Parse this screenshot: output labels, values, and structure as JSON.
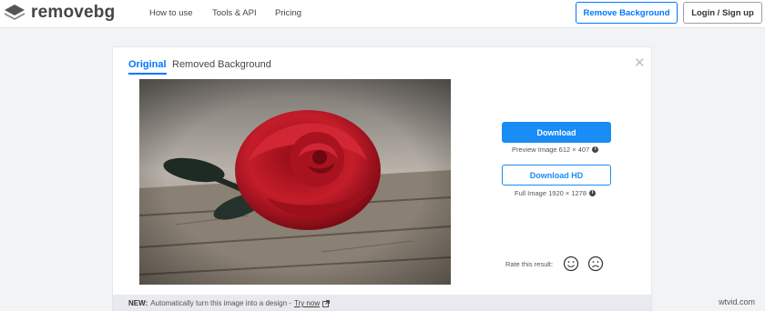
{
  "header": {
    "logo_text_a": "remove",
    "logo_text_b": "bg",
    "nav": [
      "How to use",
      "Tools & API",
      "Pricing"
    ],
    "remove_bg_button": "Remove Background",
    "login_button": "Login / Sign up"
  },
  "card": {
    "tabs": [
      "Original",
      "Removed Background"
    ],
    "active_tab": "Original",
    "download_button": "Download",
    "preview_caption": "Preview Image 612 × 407",
    "download_hd_button": "Download HD",
    "full_caption": "Full Image 1920 × 1278",
    "rate_label": "Rate this result:",
    "footer_new": "NEW:",
    "footer_text": "Automatically turn this image into a design -",
    "footer_link": "Try now"
  },
  "watermark": "wtvid.com",
  "colors": {
    "accent": "#0077ff",
    "download_fill": "#1a8cf5",
    "page_bg": "#f2f3f5"
  },
  "icons": {
    "logo": "layers-logo-icon",
    "close": "close-icon",
    "info": "info-icon",
    "smile": "smile-face-icon",
    "frown": "frown-face-icon",
    "external": "external-link-icon"
  }
}
